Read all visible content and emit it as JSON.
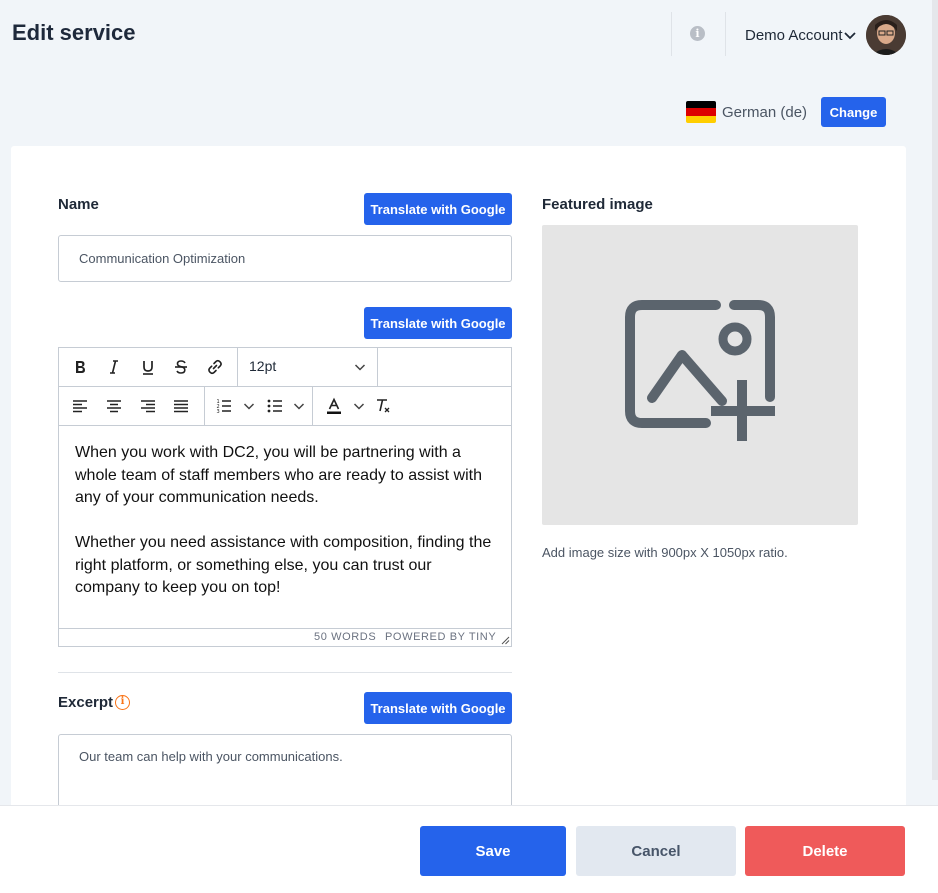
{
  "header": {
    "title": "Edit service",
    "info_icon": "i",
    "account_name": "Demo Account"
  },
  "language": {
    "label": "German (de)",
    "change_label": "Change",
    "flag_colors": [
      "#000000",
      "#dd0000",
      "#ffce00"
    ]
  },
  "form": {
    "name_label": "Name",
    "translate_label": "Translate with Google",
    "name_value": "Communication Optimization",
    "editor": {
      "font_size": "12pt",
      "paragraphs": [
        "When you work with DC2, you will be partnering with a whole team of staff members who are ready to assist with any of your communication needs.",
        "Whether you need assistance with composition, finding the right platform, or something else, you can trust our company to keep you on top!"
      ],
      "word_count": "50 WORDS",
      "powered_by": "POWERED BY TINY"
    },
    "excerpt_label": "Excerpt",
    "excerpt_info": "i",
    "excerpt_value": "Our team can help with your communications."
  },
  "featured_image": {
    "label": "Featured image",
    "hint": "Add image size with 900px X 1050px ratio."
  },
  "footer": {
    "save_label": "Save",
    "cancel_label": "Cancel",
    "delete_label": "Delete"
  },
  "colors": {
    "primary": "#2563eb",
    "danger": "#ef5a5a",
    "neutral": "#e2e8f0",
    "warning": "#f97316"
  }
}
